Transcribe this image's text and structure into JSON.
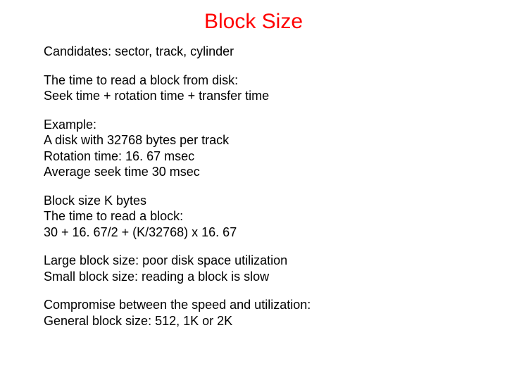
{
  "title": "Block Size",
  "p1": {
    "l1": "Candidates: sector, track, cylinder"
  },
  "p2": {
    "l1": "The time to read a block from disk:",
    "l2": "Seek time + rotation time + transfer time"
  },
  "p3": {
    "l1": "Example:",
    "l2": "A disk with 32768 bytes per track",
    "l3": "Rotation time: 16. 67 msec",
    "l4": "Average seek time 30 msec"
  },
  "p4": {
    "l1": "Block size K bytes",
    "l2": "The time to read a block:",
    "l3": "30 + 16. 67/2 + (K/32768) x 16. 67"
  },
  "p5": {
    "l1": "Large block size: poor disk space utilization",
    "l2": "Small block size: reading a block is slow"
  },
  "p6": {
    "l1": "Compromise between the speed and utilization:",
    "l2": "General block size: 512, 1K or 2K"
  }
}
